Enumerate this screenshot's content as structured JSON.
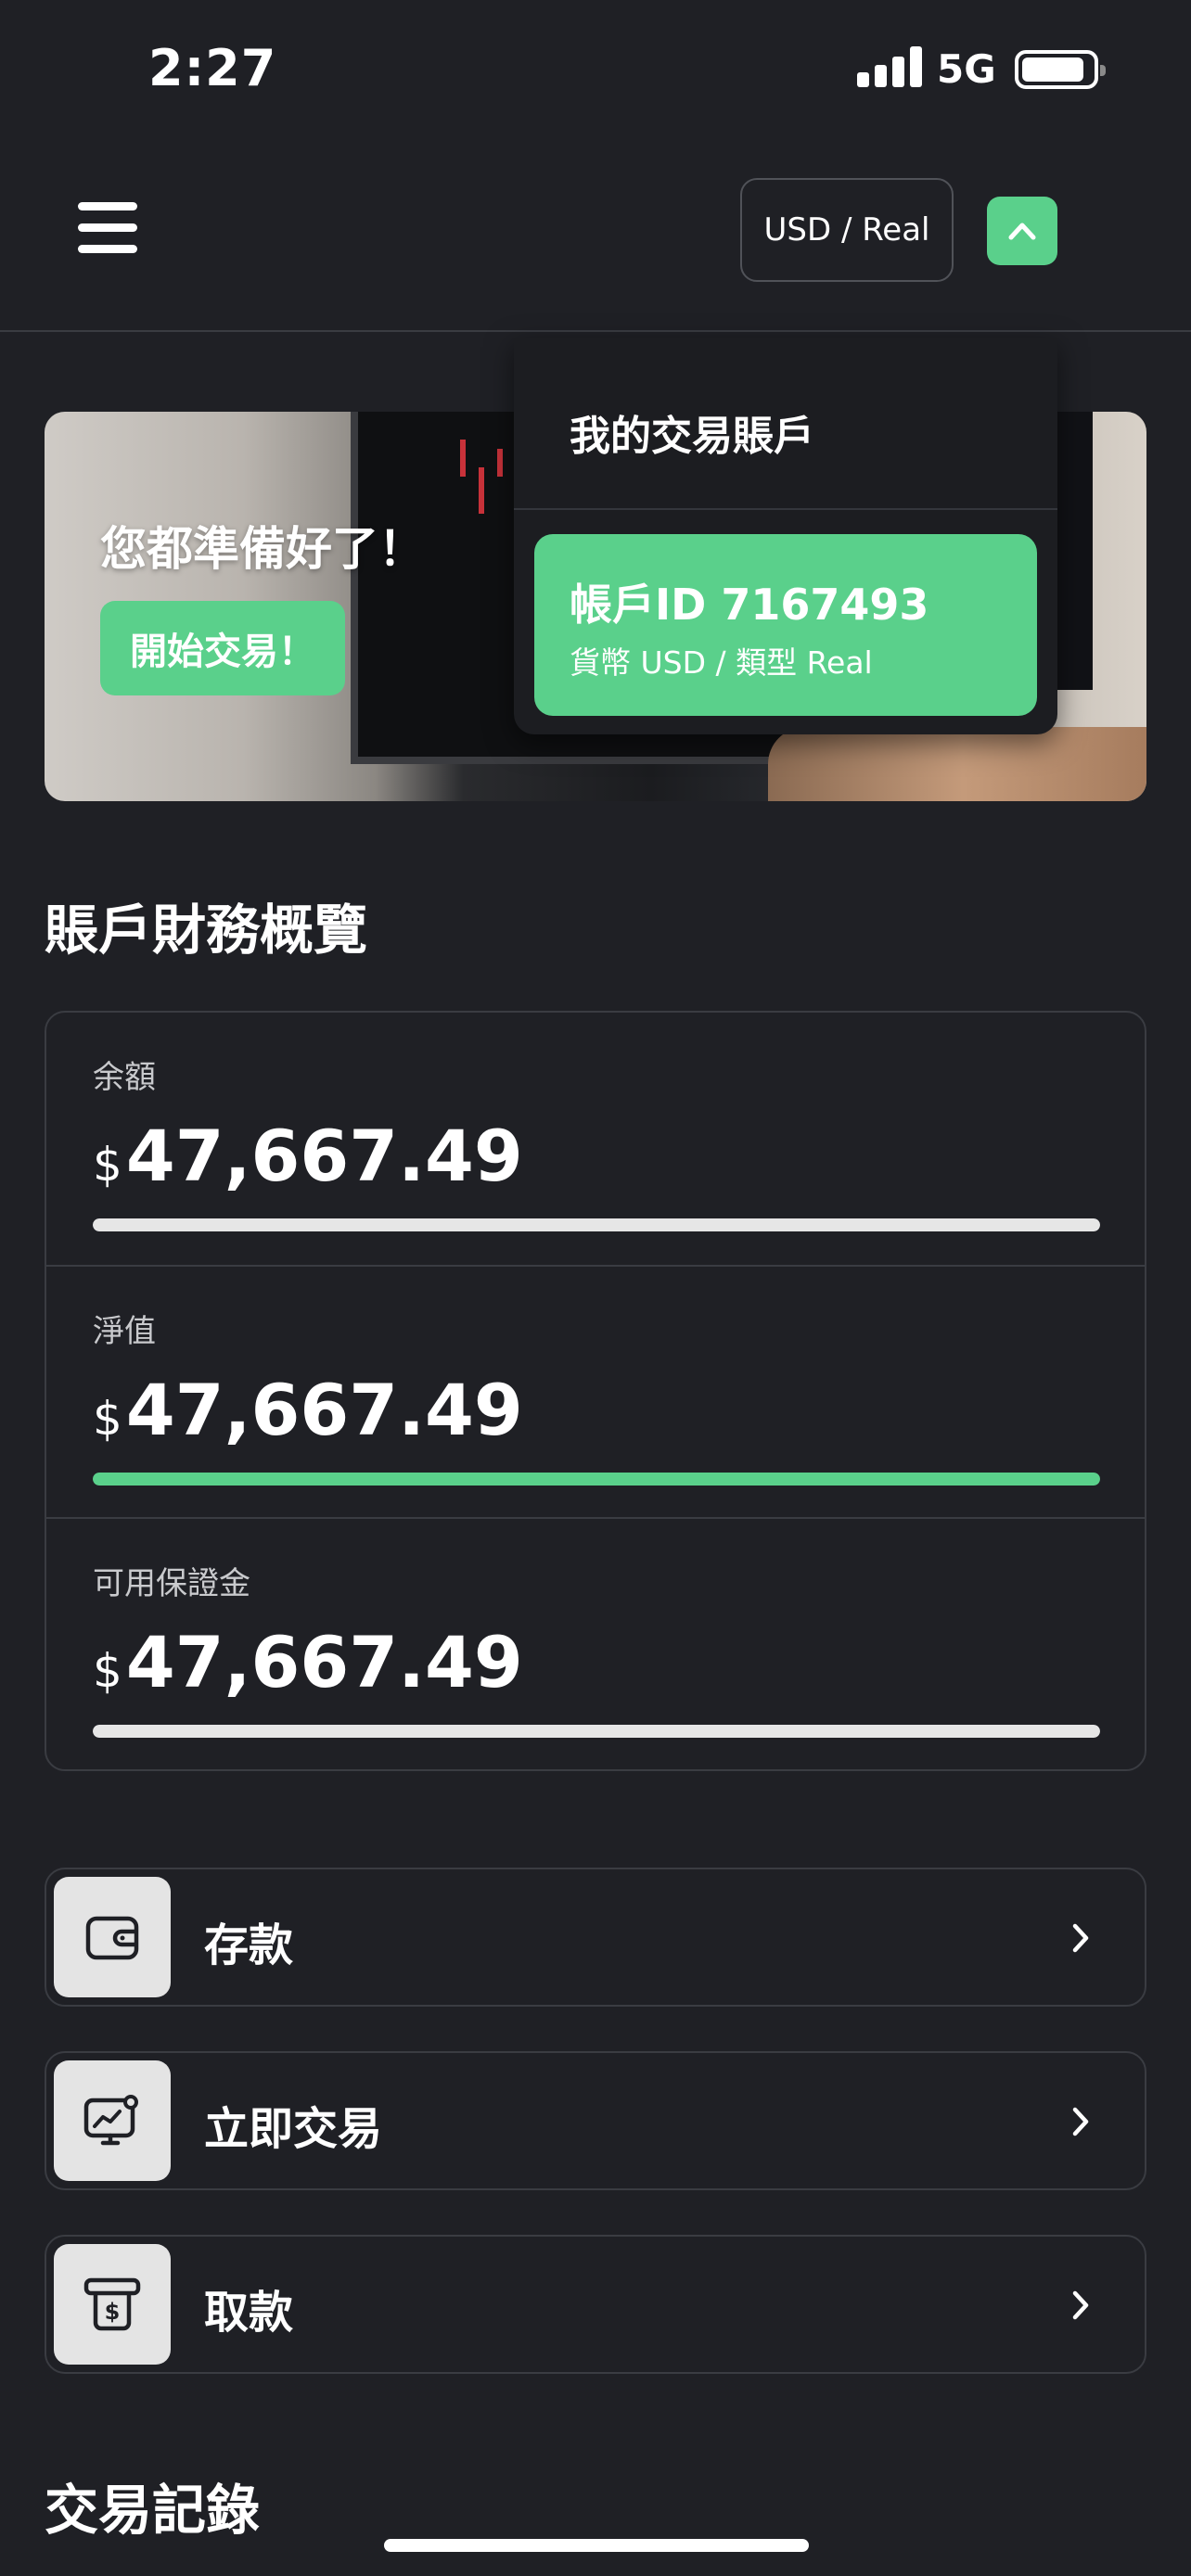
{
  "status_bar": {
    "time": "2:27",
    "network": "5G"
  },
  "header": {
    "account_selector": "USD / Real"
  },
  "hero": {
    "title": "您都準備好了！",
    "cta_label": "開始交易！"
  },
  "dropdown": {
    "title": "我的交易賬戶",
    "account": {
      "id_line": "帳戶ID 7167493",
      "detail_line": "貨幣 USD / 類型 Real"
    }
  },
  "overview": {
    "title": "賬戶財務概覽",
    "currency_symbol": "$",
    "rows": [
      {
        "label": "余額",
        "amount": "47,667.49",
        "bar_fill": 1.0,
        "bar_color": "#e6e6e6"
      },
      {
        "label": "淨值",
        "amount": "47,667.49",
        "bar_fill": 1.0,
        "bar_color": "#5ad08b"
      },
      {
        "label": "可用保證金",
        "amount": "47,667.49",
        "bar_fill": 1.0,
        "bar_color": "#e6e6e6"
      }
    ]
  },
  "actions": [
    {
      "label": "存款",
      "icon": "wallet-icon"
    },
    {
      "label": "立即交易",
      "icon": "chart-monitor-icon"
    },
    {
      "label": "取款",
      "icon": "cash-withdraw-icon"
    }
  ],
  "history": {
    "title": "交易記錄"
  },
  "colors": {
    "accent": "#5ad08b",
    "background": "#1f2025",
    "border": "#3a3c42"
  }
}
